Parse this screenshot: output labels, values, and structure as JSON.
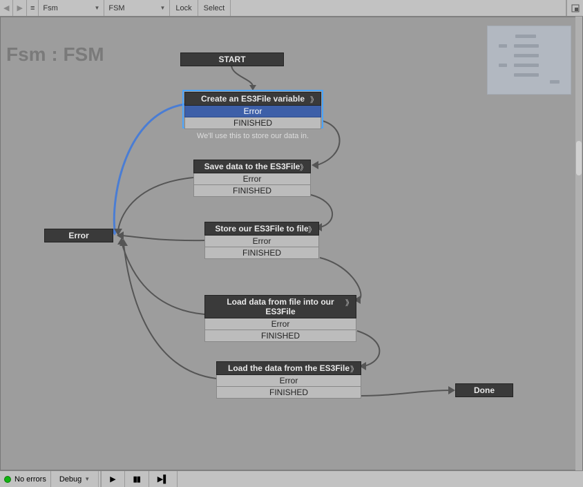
{
  "toolbar": {
    "dropdown1": "Fsm",
    "dropdown2": "FSM",
    "lock": "Lock",
    "select": "Select"
  },
  "title": "Fsm : FSM",
  "start": {
    "label": "START"
  },
  "nodes": {
    "create": {
      "title": "Create an ES3File variable",
      "row1": "Error",
      "row2": "FINISHED",
      "desc": "We'll use this to store our data in."
    },
    "savedata": {
      "title": "Save data to the ES3File",
      "row1": "Error",
      "row2": "FINISHED"
    },
    "store": {
      "title": "Store our ES3File to file",
      "row1": "Error",
      "row2": "FINISHED"
    },
    "loadfile": {
      "title": "Load data from file into our ES3File",
      "row1": "Error",
      "row2": "FINISHED"
    },
    "loaddata": {
      "title": "Load the data from the ES3File",
      "row1": "Error",
      "row2": "FINISHED"
    }
  },
  "error": {
    "label": "Error"
  },
  "done": {
    "label": "Done"
  },
  "bottombar": {
    "status": "No errors",
    "debug": "Debug"
  }
}
